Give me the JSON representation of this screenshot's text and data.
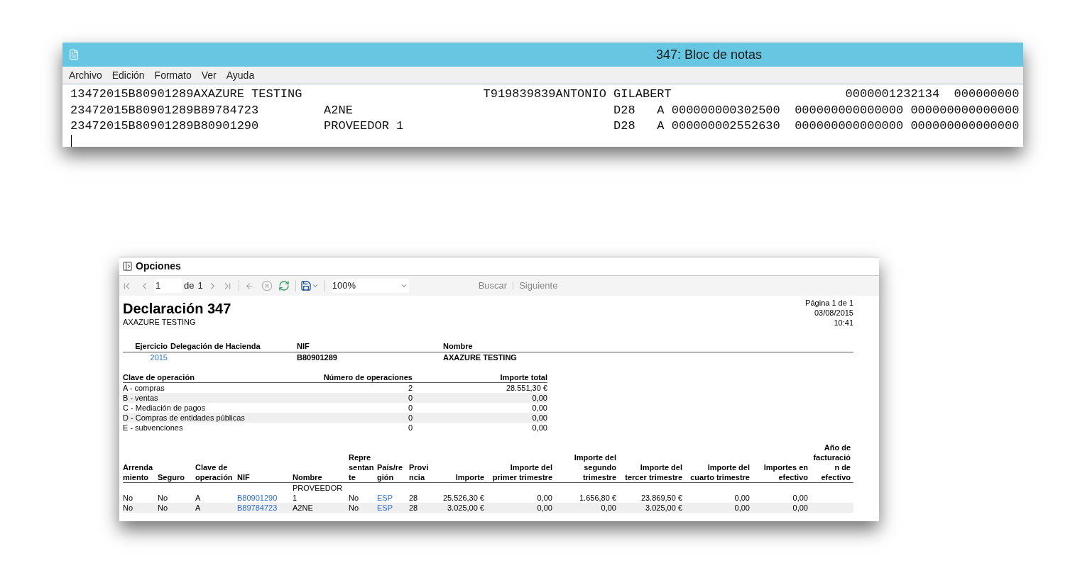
{
  "notepad": {
    "title": "347: Bloc de notas",
    "menu": [
      "Archivo",
      "Edición",
      "Formato",
      "Ver",
      "Ayuda"
    ],
    "lines": [
      "13472015B80901289AXAZURE TESTING                         T919839839ANTONIO GILABERT                        0000001232134  000000000",
      "23472015B80901289B89784723         A2NE                                    D28   A 000000000302500  000000000000000 000000000000000",
      "23472015B80901289B80901290         PROVEEDOR 1                             D28   A 000000002552630  000000000000000 000000000000000"
    ]
  },
  "report_viewer": {
    "title": "Opciones",
    "toolbar": {
      "page": "1",
      "of_label": "de",
      "total_pages": "1",
      "zoom": "100%",
      "find": "Buscar",
      "next": "Siguiente"
    },
    "report": {
      "title": "Declaración 347",
      "company": "AXAZURE TESTING",
      "page_info": "Página 1 de 1",
      "date": "03/08/2015",
      "time": "10:41",
      "header": [
        {
          "label": "Ejercicio",
          "value": "2015",
          "kind": "link"
        },
        {
          "label": "Delegación de Hacienda"
        },
        {
          "label": "NIF",
          "value": "B80901289",
          "kind": "bold"
        },
        {
          "label": "Nombre",
          "value": "AXAZURE TESTING",
          "kind": "bold"
        }
      ],
      "summary": {
        "columns": [
          "Clave de operación",
          "Número de operaciones",
          "Importe total"
        ],
        "rows": [
          [
            "A - compras",
            "2",
            "28.551,30 €"
          ],
          [
            "B - ventas",
            "0",
            "0,00"
          ],
          [
            "C - Mediación de pagos",
            "0",
            "0,00"
          ],
          [
            "D - Compras de entidades públicas",
            "0",
            "0,00"
          ],
          [
            "E - subvenciones",
            "0",
            "0,00"
          ]
        ]
      },
      "detail": {
        "columns": [
          {
            "label": "Arrendamiento",
            "kind": "text"
          },
          {
            "label": "Seguro",
            "kind": "text"
          },
          {
            "label": "Clave de operación",
            "kind": "text"
          },
          {
            "label": "NIF",
            "kind": "link"
          },
          {
            "label": "Nombre",
            "kind": "text"
          },
          {
            "label": "Representante",
            "kind": "text"
          },
          {
            "label": "País/región",
            "kind": "link"
          },
          {
            "label": "Provincia",
            "kind": "text"
          },
          {
            "label": "Importe",
            "kind": "number"
          },
          {
            "label": "Importe del primer trimestre",
            "kind": "number"
          },
          {
            "label": "Importe del segundo trimestre",
            "kind": "number"
          },
          {
            "label": "Importe del tercer trimestre",
            "kind": "number"
          },
          {
            "label": "Importe del cuarto trimestre",
            "kind": "number"
          },
          {
            "label": "Importes en efectivo",
            "kind": "number"
          },
          {
            "label": "Año de facturación de efectivo",
            "kind": "number"
          }
        ],
        "rows": [
          [
            "No",
            "No",
            "A",
            "B80901290",
            "PROVEEDOR 1",
            "No",
            "ESP",
            "28",
            "25.526,30 €",
            "0,00",
            "1.656,80 €",
            "23.869,50 €",
            "0,00",
            "0,00"
          ],
          [
            "No",
            "No",
            "A",
            "B89784723",
            "A2NE",
            "No",
            "ESP",
            "28",
            "3.025,00 €",
            "0,00",
            "0,00",
            "3.025,00 €",
            "0,00",
            "0,00"
          ]
        ]
      }
    }
  }
}
